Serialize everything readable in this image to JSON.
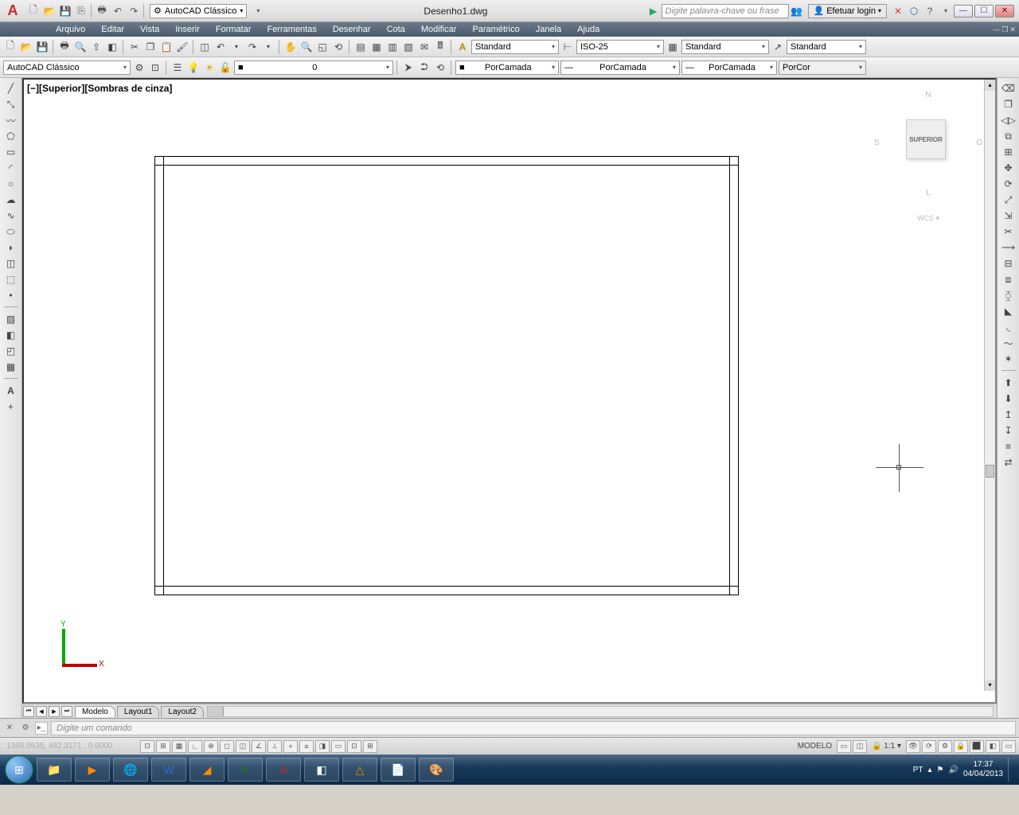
{
  "title": {
    "filename": "Desenho1.dwg",
    "workspace": "AutoCAD Clássico"
  },
  "search": {
    "placeholder": "Digite palavra-chave ou frase"
  },
  "login": {
    "label": "Efetuar login"
  },
  "menu": {
    "arquivo": "Arquivo",
    "editar": "Editar",
    "vista": "Vista",
    "inserir": "Inserir",
    "formatar": "Formatar",
    "ferramentas": "Ferramentas",
    "desenhar": "Desenhar",
    "cota": "Cota",
    "modificar": "Modificar",
    "parametrico": "Paramétrico",
    "janela": "Janela",
    "ajuda": "Ajuda"
  },
  "styles": {
    "text_style": "Standard",
    "dim_style": "ISO-25",
    "table_style": "Standard",
    "mleader_style": "Standard"
  },
  "workspace_row": {
    "selector": "AutoCAD Clássico"
  },
  "layer": {
    "current": "0"
  },
  "props": {
    "color": "PorCamada",
    "linetype": "PorCamada",
    "lineweight": "PorCamada",
    "plot_style": "PorCor"
  },
  "viewport": {
    "label": "[−][Superior][Sombras de cinza]"
  },
  "viewcube": {
    "n": "N",
    "s": "S",
    "o": "O",
    "l": "L",
    "face": "SUPERIOR",
    "wcs": "WCS ▾"
  },
  "ucs": {
    "x": "X",
    "y": "Y"
  },
  "tabs": {
    "model": "Modelo",
    "layout1": "Layout1",
    "layout2": "Layout2"
  },
  "cmd": {
    "placeholder": "Digite um comando"
  },
  "status": {
    "coords": "1365.0535, 482.3171 , 0.0000",
    "model": "MODELO",
    "scale": "1:1",
    "lang": "PT"
  },
  "clock": {
    "time": "17:37",
    "date": "04/04/2013"
  }
}
